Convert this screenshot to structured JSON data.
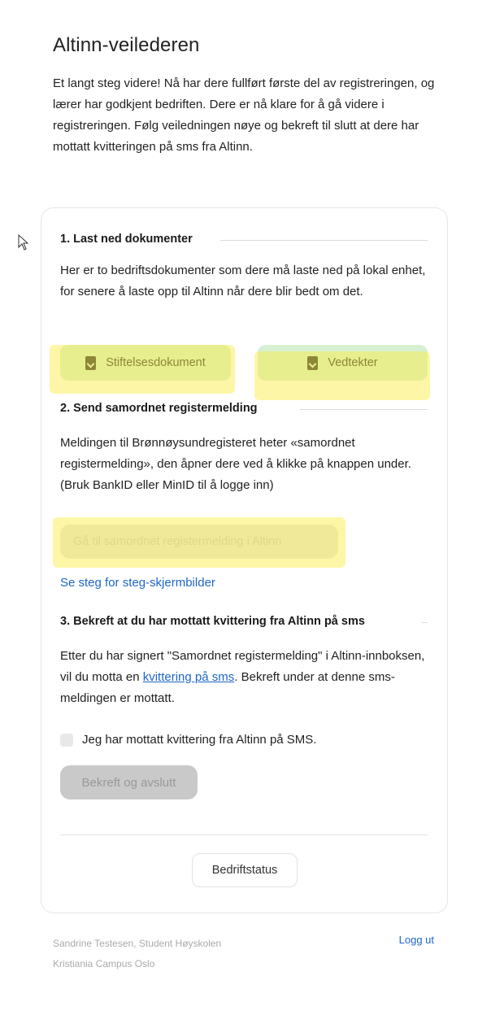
{
  "page": {
    "title": "Altinn-veilederen",
    "intro": "Et langt steg videre! Nå har dere fullført første del av registreringen, og lærer har godkjent bedriften. Dere er nå klare for å gå videre i registreringen. Følg veiledningen nøye og bekreft til slutt at dere har mottatt kvitteringen på sms fra Altinn."
  },
  "section1": {
    "title": "1. Last ned dokumenter",
    "text": "Her er to bedriftsdokumenter som dere må laste ned på lokal enhet, for senere å laste opp til Altinn når dere blir bedt om det.",
    "buttons": [
      {
        "label": "Stiftelsesdokument",
        "icon": "document-download-icon"
      },
      {
        "label": "Vedtekter",
        "icon": "document-download-icon"
      }
    ]
  },
  "section2": {
    "title": "2. Send samordnet registermelding",
    "text": "Meldingen til Brønnøysundregisteret heter «samordnet registermelding», den åpner dere ved å klikke på knappen under. (Bruk BankID eller MinID til å logge inn)",
    "button_label": "Gå til samordnet registermelding i Altinn",
    "link_label": "Se steg for steg-skjermbilder"
  },
  "section3": {
    "title": "3. Bekreft at du har mottatt kvittering fra Altinn på sms",
    "text_before": "Etter du har signert \"Samordnet registermelding\" i Altinn-innboksen, vil du motta en ",
    "link_text": "kvittering på sms",
    "text_after": ". Bekreft under at denne sms-meldingen er mottatt.",
    "checkbox_label": "Jeg har mottatt kvittering fra Altinn på SMS.",
    "confirm_label": "Bekreft og avslutt"
  },
  "status_button": "Bedriftstatus",
  "footer": {
    "user_line1": "Sandrine Testesen, Student Høyskolen",
    "user_line2": "Kristiania Campus Oslo",
    "logout": "Logg ut"
  },
  "colors": {
    "download_button_bg": "#d7f0d1",
    "link": "#1e66c8",
    "highlight": "#faeb3c",
    "disabled_button": "#c9c9c9"
  }
}
